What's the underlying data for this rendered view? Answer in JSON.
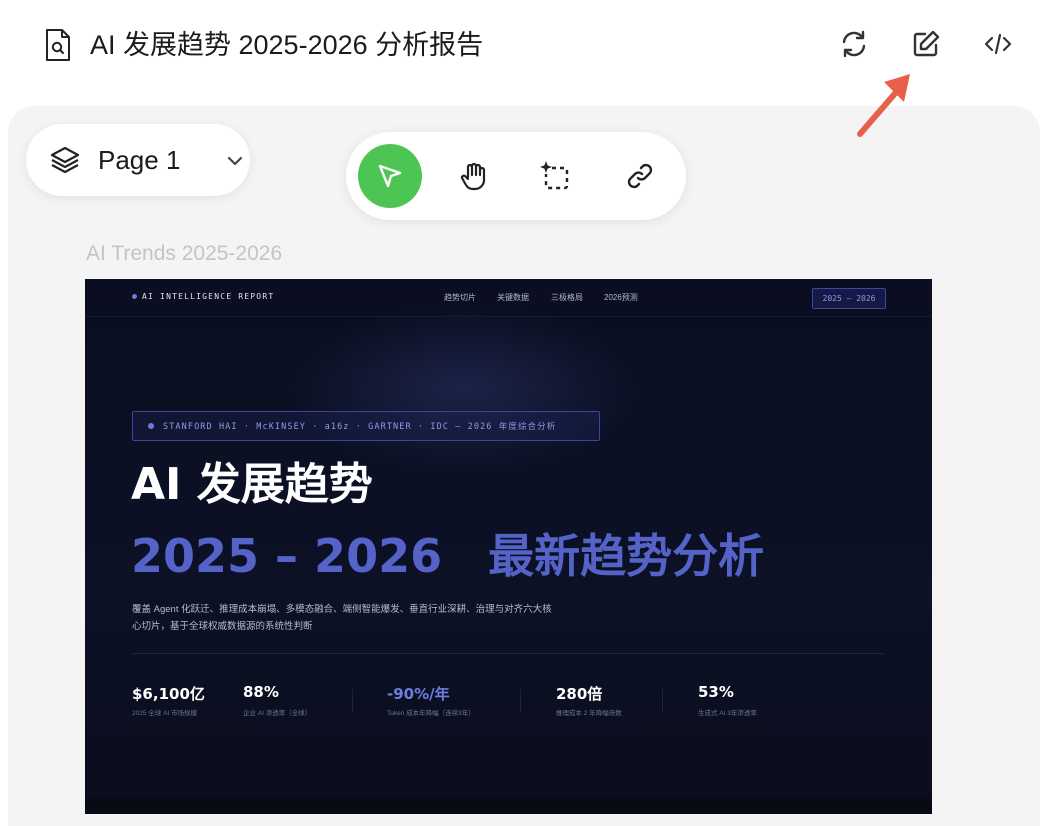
{
  "header": {
    "title": "AI 发展趋势 2025-2026 分析报告",
    "icons": [
      "document-icon",
      "refresh-icon",
      "edit-icon",
      "code-icon"
    ]
  },
  "page_selector": {
    "label": "Page 1"
  },
  "toolbar": {
    "tools": [
      "select",
      "hand",
      "ai-frame",
      "link"
    ],
    "active": "select",
    "active_color": "#4dc552"
  },
  "frame": {
    "label": "AI Trends 2025-2026"
  },
  "report": {
    "brand": "AI INTELLIGENCE REPORT",
    "nav": [
      "趋势切片",
      "关键数据",
      "三极格局",
      "2026预测"
    ],
    "badge": "2025 — 2026",
    "sources": "STANFORD HAI · McKINSEY · a16z · GARTNER · IDC — 2026 年度综合分析",
    "title_line1": "AI 发展趋势",
    "title_year": "2025 – 2026",
    "title_sub": "最新趋势分析",
    "description": "覆盖 Agent 化跃迁、推理成本崩塌、多模态融合、端侧智能爆发、垂直行业深耕、治理与对齐六大核心切片，基于全球权威数据源的系统性判断",
    "stats": [
      {
        "value": "$6,100亿",
        "label": "2025 全球 AI 市场规模"
      },
      {
        "value": "88%",
        "label": "企业 AI 渗透率（全球）"
      },
      {
        "value": "-90%/年",
        "label": "Token 成本年降幅（连续3年）"
      },
      {
        "value": "280倍",
        "label": "推理成本 2 年降幅倍数"
      },
      {
        "value": "53%",
        "label": "生成式 AI 3年渗透率"
      }
    ],
    "colors": {
      "background": "#0a0e20",
      "accent": "#5563c8",
      "title": "#ffffff"
    }
  },
  "annotation": {
    "color": "#e8604c"
  }
}
